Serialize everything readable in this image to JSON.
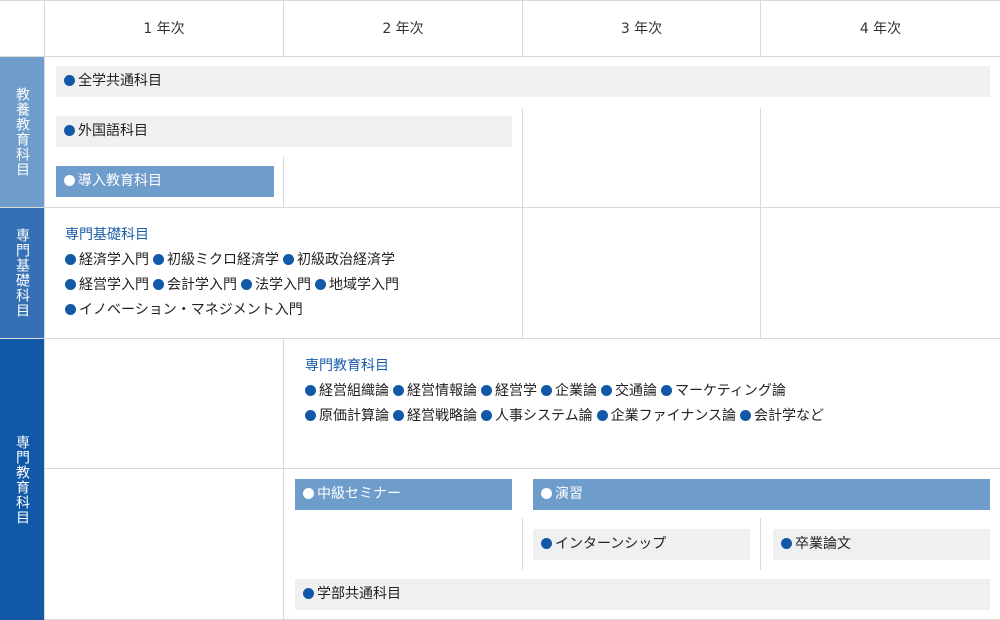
{
  "years": [
    "1 年次",
    "2 年次",
    "3 年次",
    "4 年次"
  ],
  "categories": {
    "kyoyo": "教養教育科目",
    "senmon_kiso": "専門基礎科目",
    "senmon": "専門教育科目"
  },
  "colors": {
    "side_light": "#6e9ccb",
    "side_mid": "#3570b5",
    "side_dark": "#1159a7",
    "box_gray": "#f0f0f0",
    "title_blue": "#1a5ca8"
  },
  "boxes": {
    "zengaku": "全学共通科目",
    "gaikokugo": "外国語科目",
    "donyu": "導入教育科目",
    "chukyu": "中級セミナー",
    "enshu": "演習",
    "intern": "インターンシップ",
    "sotsugyo": "卒業論文",
    "gakubu": "学部共通科目"
  },
  "kiso": {
    "title": "専門基礎科目",
    "rows": [
      [
        "経済学入門",
        "初級ミクロ経済学",
        "初級政治経済学"
      ],
      [
        "経営学入門",
        "会計学入門",
        "法学入門",
        "地域学入門"
      ],
      [
        "イノベーション・マネジメント入門"
      ]
    ]
  },
  "senmon": {
    "title": "専門教育科目",
    "rows": [
      [
        "経営組織論",
        "経営情報論",
        "経営学",
        "企業論",
        "交通論",
        "マーケティング論"
      ],
      [
        "原価計算論",
        "経営戦略論",
        "人事システム論",
        "企業ファイナンス論",
        "会計学など"
      ]
    ]
  }
}
